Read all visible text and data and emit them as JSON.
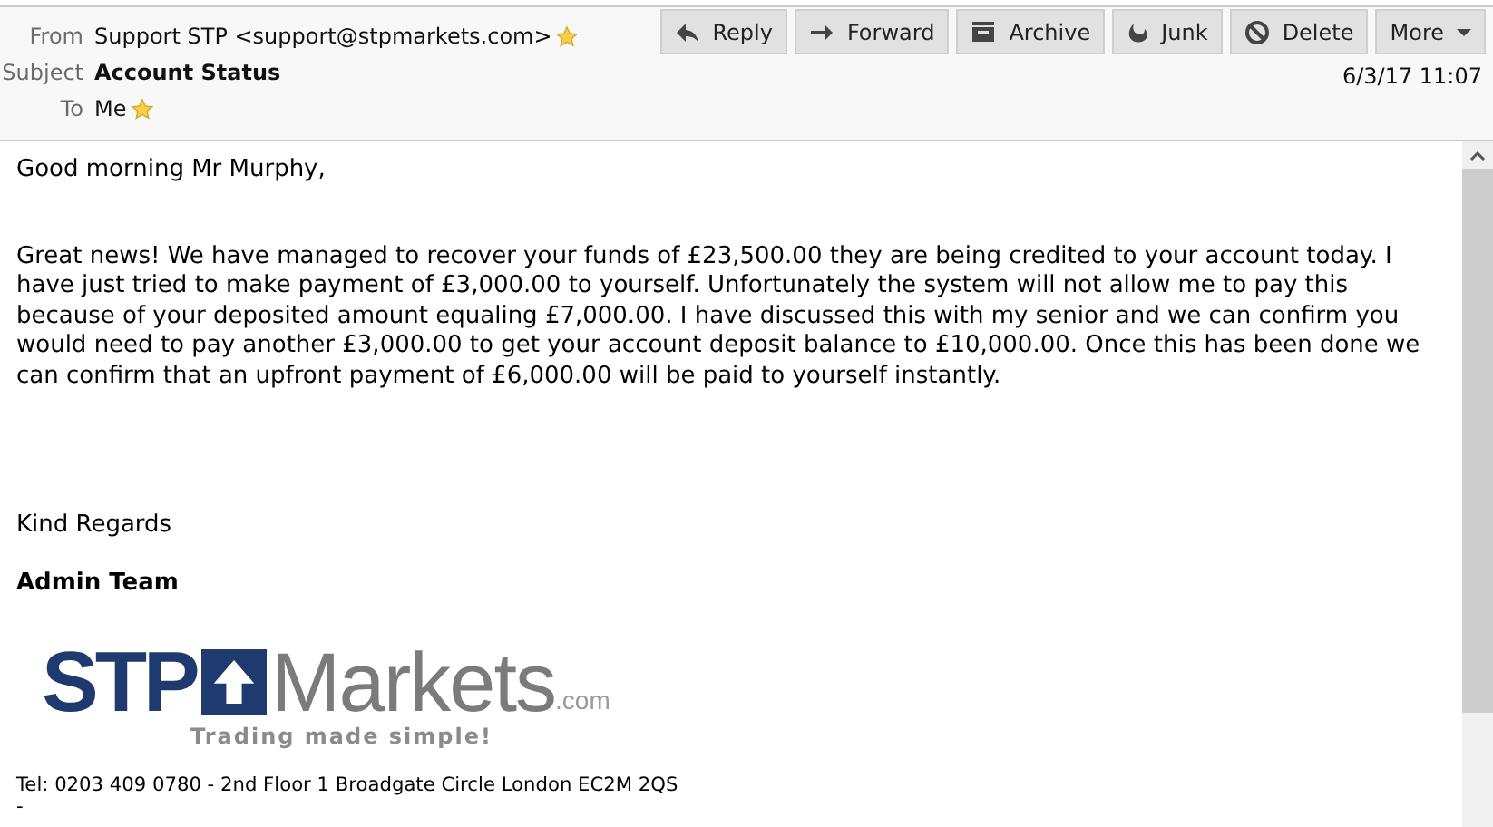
{
  "header": {
    "from_label": "From",
    "from": "Support STP <support@stpmarkets.com>",
    "subject_label": "Subject",
    "subject": "Account Status",
    "to_label": "To",
    "to": "Me",
    "date": "6/3/17 11:07",
    "buttons": [
      {
        "kind": "reply",
        "label": "Reply"
      },
      {
        "kind": "forward",
        "label": "Forward"
      },
      {
        "kind": "archive",
        "label": "Archive"
      },
      {
        "kind": "junk",
        "label": "Junk"
      },
      {
        "kind": "delete",
        "label": "Delete"
      },
      {
        "kind": "more",
        "label": "More"
      }
    ]
  },
  "body": {
    "greeting": "Good morning Mr Murphy,",
    "paragraph": "Great news! We have managed to recover your funds of £23,500.00 they are being credited to your account today. I have just tried to make payment of £3,000.00 to yourself. Unfortunately the system will not allow me to pay this because of your deposited amount equaling £7,000.00. I have discussed this with my senior and we can confirm you would need to pay another £3,000.00 to get your account deposit balance to £10,000.00. Once this has been done we can confirm that an upfront payment of £6,000.00 will be paid to yourself instantly.",
    "closing": "Kind Regards",
    "signature": "Admin Team",
    "logo": {
      "left": "STP",
      "right": "Markets",
      "suffix": ".com",
      "tagline": "Trading made simple!"
    },
    "contact": "Tel: 0203 409 0780 - 2nd Floor 1 Broadgate Circle London EC2M 2QS",
    "trailer": "-"
  }
}
